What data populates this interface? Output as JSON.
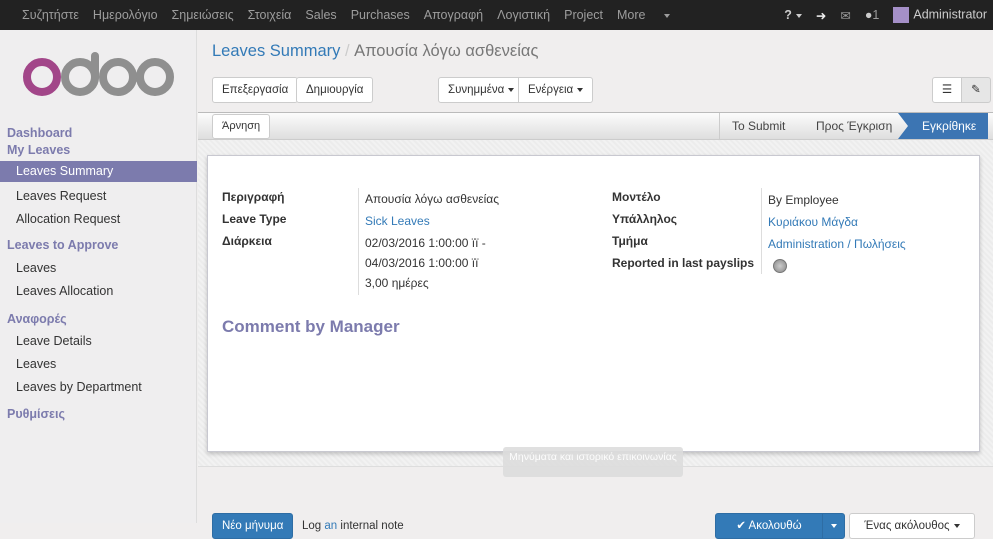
{
  "topbar": {
    "menu": [
      "Συζητήστε",
      "Ημερολόγιο",
      "Σημειώσεις",
      "Στοιχεία",
      "Sales",
      "Purchases",
      "Απογραφή",
      "Λογιστική",
      "Project",
      "More"
    ],
    "message_count": "1",
    "user": "Administrator",
    "icons": [
      "help-icon",
      "logout-icon",
      "mail-icon",
      "chat-icon"
    ]
  },
  "logo": "odoo",
  "sidebar": {
    "sections": [
      {
        "label": "Dashboard"
      },
      {
        "label": "My Leaves",
        "items": [
          "Leaves Summary",
          "Leaves Request",
          "Allocation Request"
        ]
      },
      {
        "label": "Leaves to Approve",
        "items": [
          "Leaves",
          "Leaves Allocation"
        ]
      },
      {
        "label": "Αναφορές",
        "items": [
          "Leave Details",
          "Leaves",
          "Leaves by Department"
        ]
      },
      {
        "label": "Ρυθμίσεις"
      }
    ],
    "active": "Leaves Summary",
    "accent": "#7c7bad"
  },
  "breadcrumb": {
    "parent": "Leaves Summary",
    "current": "Απουσία λόγω ασθενείας"
  },
  "toolbar": {
    "edit": "Επεξεργασία",
    "create": "Δημιουργία",
    "attachments": "Συνημμένα",
    "actions": "Ενέργεια"
  },
  "statusbar": {
    "refuse": "Άρνηση",
    "stages": [
      "To Submit",
      "Προς Έγκριση",
      "Εγκρίθηκε"
    ],
    "active": "Εγκρίθηκε"
  },
  "form": {
    "labels": {
      "description": "Περιγραφή",
      "leave_type": "Leave Type",
      "duration": "Διάρκεια",
      "mode": "Μοντέλο",
      "employee": "Υπάλληλος",
      "department": "Τμήμα",
      "reported": "Reported in last payslips"
    },
    "values": {
      "description": "Απουσία λόγω ασθενείας",
      "leave_type": "Sick Leaves",
      "date_from": "02/03/2016 1:00:00 ïï",
      "date_sep": "-",
      "date_to": "04/03/2016 1:00:00 ïï",
      "days": "3,00",
      "days_unit": "ημέρες",
      "mode": "By Employee",
      "employee": "Κυριάκου Μάγδα",
      "department": "Administration / Πωλήσεις",
      "reported": false
    },
    "comment_title": "Comment by Manager"
  },
  "chatter": {
    "tooltip": "Μηνύματα και ιστορικό επικοινωνίας",
    "new_message": "Νέο μήνυμα",
    "log_note_prefix": "Log ",
    "log_note_an": "an",
    "log_note_suffix": " internal note",
    "follow": "✔ Ακολουθώ",
    "followers": "Ένας ακόλουθος"
  }
}
